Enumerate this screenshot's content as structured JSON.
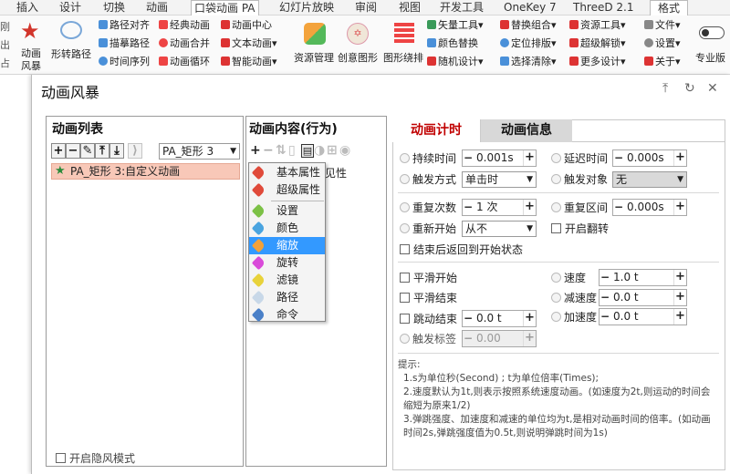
{
  "ribbon_tabs": [
    "插入",
    "设计",
    "切换",
    "动画",
    "口袋动画 PA",
    "幻灯片放映",
    "审阅",
    "视图",
    "开发工具",
    "OneKey 7",
    "ThreeD 2.1",
    "格式"
  ],
  "ribbon": {
    "left_btns": [
      "动画",
      "风暴"
    ],
    "rotate_path": "形转路径",
    "col2": [
      "路径对齐",
      "描摹路径",
      "时间序列"
    ],
    "col3": [
      "经典动画",
      "动画合并",
      "动画循环"
    ],
    "col4": [
      "动画中心",
      "文本动画",
      "智能动画"
    ],
    "big": [
      "资源管理",
      "创意图形",
      "图形绕排"
    ],
    "col5": [
      "矢量工具",
      "颜色替换",
      "随机设计"
    ],
    "col6": [
      "替换组合",
      "定位排版",
      "选择清除"
    ],
    "col7": [
      "资源工具",
      "超级解锁",
      "更多设计"
    ],
    "col8": [
      "文件",
      "设置",
      "关于"
    ],
    "pro": "专业版",
    "edge": [
      "刚",
      "出",
      "占"
    ]
  },
  "dialog": {
    "title": "动画风暴",
    "list_header": "动画列表",
    "content_header": "动画内容(行为)",
    "object_select": "PA_矩形 3",
    "list_item": "PA_矩形 3:自定义动画",
    "hidden_mode": "开启隐风模式",
    "partial_item": "见性"
  },
  "menu_items": [
    "基本属性",
    "超级属性",
    "设置",
    "颜色",
    "缩放",
    "旋转",
    "滤镜",
    "路径",
    "命令"
  ],
  "tabs": [
    "动画计时",
    "动画信息"
  ],
  "timing": {
    "duration": {
      "label": "持续时间",
      "value": "0.001s"
    },
    "delay": {
      "label": "延迟时间",
      "value": "0.000s"
    },
    "trigger_mode": {
      "label": "触发方式",
      "value": "单击时"
    },
    "trigger_obj": {
      "label": "触发对象",
      "value": "无"
    },
    "repeat": {
      "label": "重复次数",
      "value": "1 次"
    },
    "repeat_interval": {
      "label": "重复区间",
      "value": "0.000s"
    },
    "restart": {
      "label": "重新开始",
      "value": "从不"
    },
    "flip": "开启翻转",
    "rewind": "结束后返回到开始状态",
    "smooth_start": "平滑开始",
    "smooth_end": "平滑结束",
    "bounce_end": {
      "label": "跳动结束",
      "value": "0.0 t"
    },
    "trigger_tag": {
      "label": "触发标签",
      "value": "0.00"
    },
    "speed": {
      "label": "速度",
      "value": "1.0 t"
    },
    "decel": {
      "label": "减速度",
      "value": "0.0 t"
    },
    "accel": {
      "label": "加速度",
      "value": "0.0 t"
    }
  },
  "tips": {
    "title": "提示:",
    "lines": [
      "1.s为单位秒(Second) ; t为单位倍率(Times);",
      "2.速度默认为1t,则表示按照系统速度动画。(如速度为2t,则运动的时间会缩短为原来1/2)",
      "3.弹跳强度、加速度和减速的单位均为t,是相对动画时间的倍率。(如动画时间2s,弹跳强度值为0.5t,则说明弹跳时间为1s)"
    ]
  },
  "colors": {
    "accent": "#c00000",
    "selection": "#f8c8b8",
    "menu_highlight": "#3399ff"
  },
  "tag_colors": [
    "#e04a3a",
    "#e04a3a",
    "#7cc146",
    "#4aa4e0",
    "#f2a13a",
    "#d94ad9",
    "#e8d23a",
    "#c8d8e8",
    "#4a80c8"
  ]
}
